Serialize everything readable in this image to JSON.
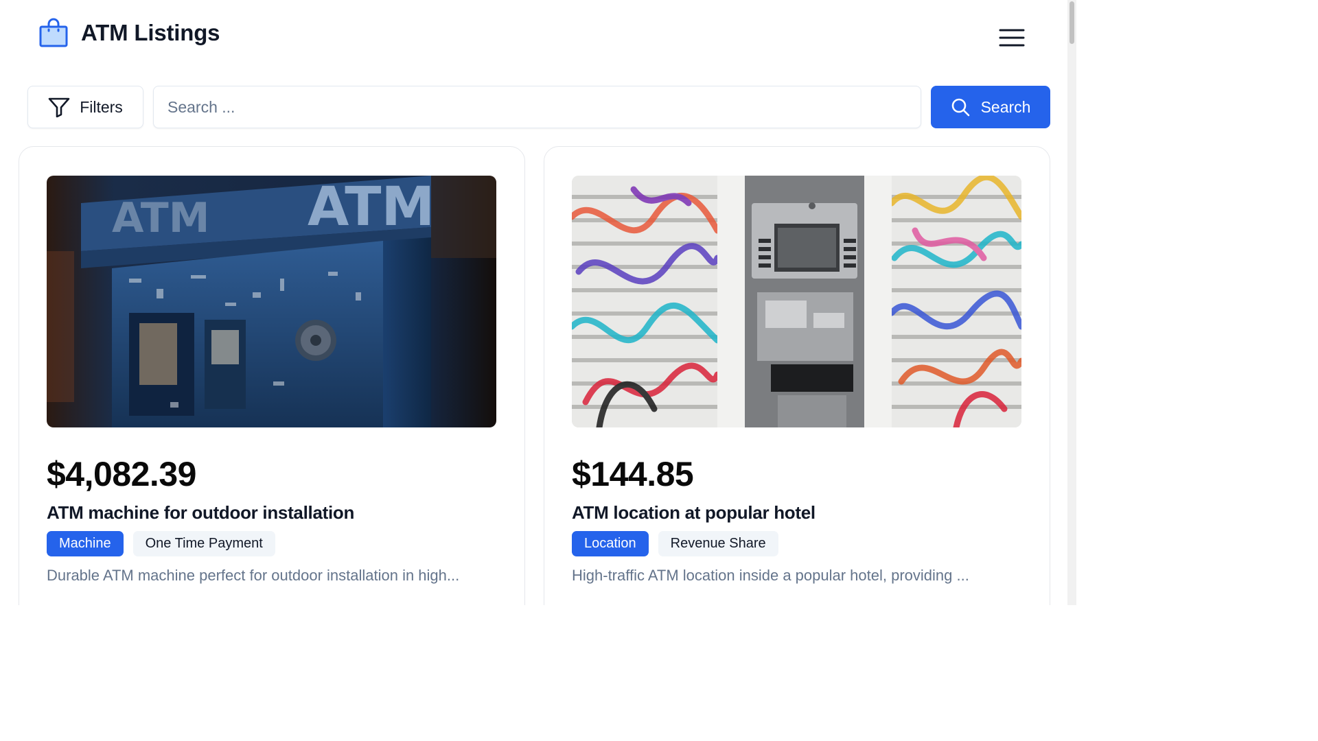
{
  "app": {
    "title": "ATM Listings",
    "brand_icon": "shopping-bag-icon",
    "menu_icon": "hamburger-menu-icon"
  },
  "toolbar": {
    "filters_label": "Filters",
    "filters_icon": "filter-funnel-icon",
    "search_placeholder": "Search ...",
    "search_value": "",
    "search_button_label": "Search",
    "search_icon": "search-icon"
  },
  "listings": [
    {
      "price": "$4,082.39",
      "title": "ATM machine for outdoor installation",
      "tags": [
        "Machine",
        "One Time Payment"
      ],
      "description": "Durable ATM machine perfect for outdoor installation in high...",
      "image": "blue-outdoor-atm-photo"
    },
    {
      "price": "$144.85",
      "title": "ATM location at popular hotel",
      "tags": [
        "Location",
        "Revenue Share"
      ],
      "description": "High-traffic ATM location inside a popular hotel, providing ...",
      "image": "graffiti-wall-atm-photo"
    }
  ],
  "colors": {
    "accent": "#2563eb",
    "tag_secondary_bg": "#f1f5f9",
    "muted_text": "#64748b",
    "border": "#e5e7eb"
  }
}
